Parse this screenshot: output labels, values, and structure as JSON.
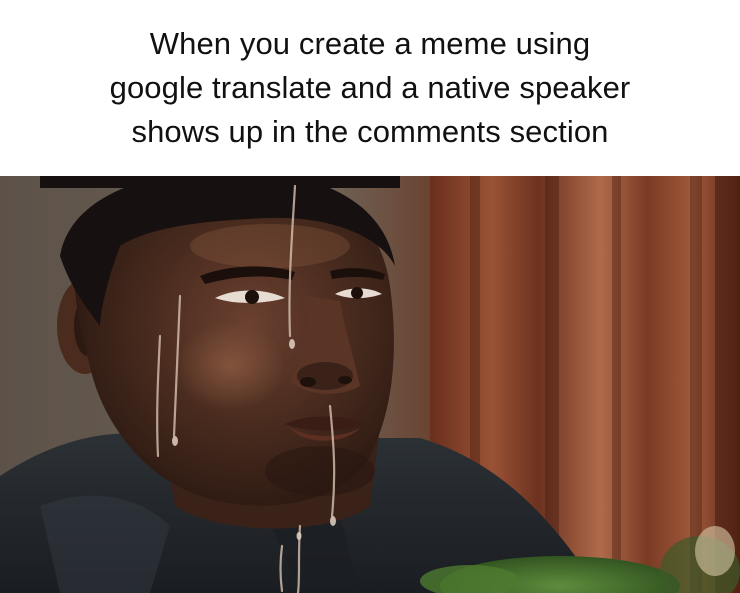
{
  "caption": {
    "lines": [
      "When you create a meme using",
      "google translate and a native speaker",
      "shows up in the comments section"
    ]
  },
  "photo": {
    "subject": "sweating nervous man",
    "palette": {
      "background_left": "#6b5f52",
      "curtain_red": "#7a3a22",
      "curtain_highlight": "#b0684a",
      "skin": "#3b2418",
      "skin_highlight": "#8a5a40",
      "hair": "#161010",
      "shirt": "#25292e",
      "foliage": "#3f6b2c"
    }
  }
}
